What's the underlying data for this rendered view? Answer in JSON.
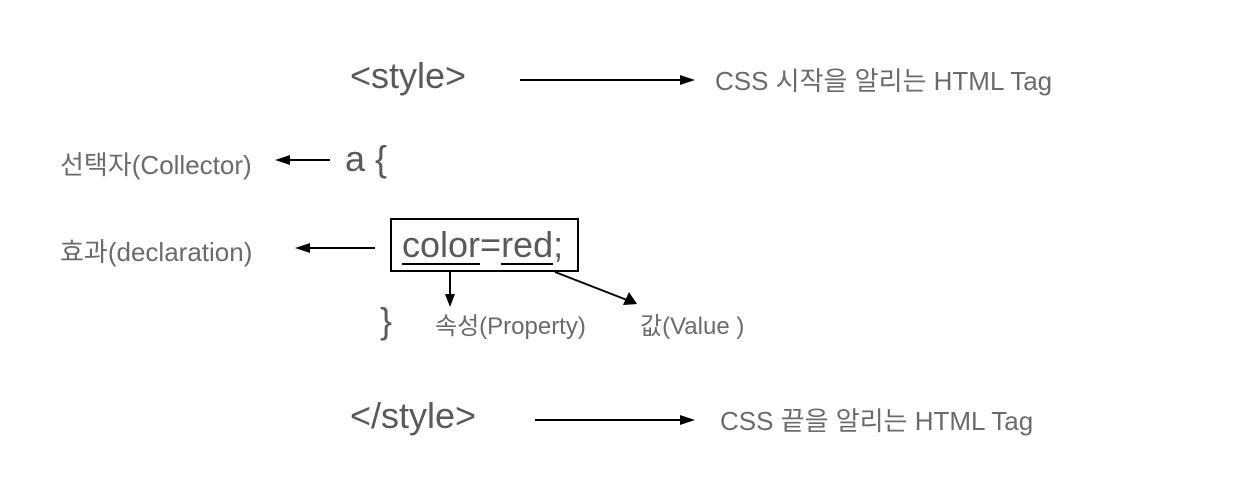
{
  "code": {
    "style_open": "<style>",
    "selector": "a {",
    "declaration_prefix": "color",
    "declaration_eq": "=",
    "declaration_value": "red",
    "declaration_suffix": ";",
    "close_brace": "}",
    "style_close": "</style>"
  },
  "labels": {
    "css_start": "CSS 시작을 알리는 HTML Tag",
    "selector_label": "선택자(Collector)",
    "declaration_label": "효과(declaration)",
    "property_label": "속성(Property)",
    "value_label": "값(Value )",
    "css_end": "CSS 끝을 알리는 HTML Tag"
  }
}
